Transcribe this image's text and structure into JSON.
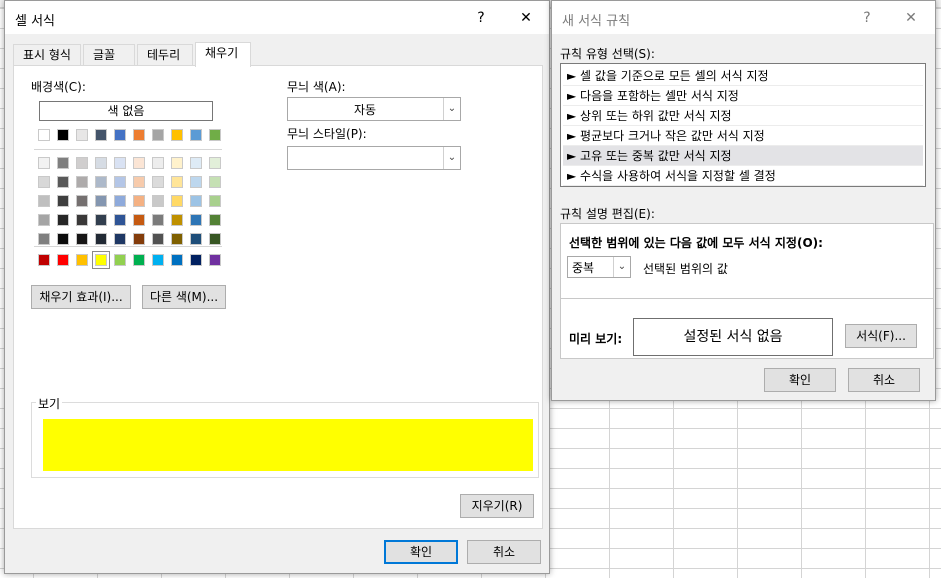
{
  "cell_format_dialog": {
    "title": "셀 서식",
    "help_glyph": "?",
    "close_glyph": "✕",
    "tabs": [
      {
        "label": "표시 형식",
        "active": false
      },
      {
        "label": "글꼴",
        "active": false
      },
      {
        "label": "테두리",
        "active": false
      },
      {
        "label": "채우기",
        "active": true
      }
    ],
    "background_color_label": "배경색(C):",
    "no_color_label": "색 없음",
    "pattern_color_label": "무늬 색(A):",
    "pattern_color_value": "자동",
    "pattern_style_label": "무늬 스타일(P):",
    "pattern_style_value": "",
    "fill_effects_button": "채우기 효과(I)...",
    "more_colors_button": "다른 색(M)...",
    "sample_label": "보기",
    "sample_color": "#ffff00",
    "clear_button": "지우기(R)",
    "ok_button": "확인",
    "cancel_button": "취소",
    "palette": {
      "theme_row": [
        "#ffffff",
        "#000000",
        "#e7e6e6",
        "#44546a",
        "#4472c4",
        "#ed7d31",
        "#a5a5a5",
        "#ffc000",
        "#5b9bd5",
        "#70ad47"
      ],
      "shades": [
        [
          "#f2f2f2",
          "#7f7f7f",
          "#d0cece",
          "#d6dce4",
          "#d9e2f3",
          "#fbe5d5",
          "#ededed",
          "#fff2cc",
          "#deebf6",
          "#e2efd9"
        ],
        [
          "#d8d8d8",
          "#595959",
          "#aeabab",
          "#adb9ca",
          "#b4c6e7",
          "#f7cbac",
          "#dbdbdb",
          "#ffe599",
          "#bdd7ee",
          "#c5e0b3"
        ],
        [
          "#bfbfbf",
          "#3f3f3f",
          "#757070",
          "#8496b0",
          "#8eaadb",
          "#f4b183",
          "#c9c9c9",
          "#ffd966",
          "#9cc3e5",
          "#a8d08d"
        ],
        [
          "#a5a5a5",
          "#262626",
          "#3a3838",
          "#323f4f",
          "#2f5496",
          "#c55a11",
          "#7b7b7b",
          "#bf9000",
          "#2e75b5",
          "#538135"
        ],
        [
          "#7f7f7f",
          "#0c0c0c",
          "#171616",
          "#222a35",
          "#1f3864",
          "#833c0b",
          "#525252",
          "#7f6000",
          "#1e4e79",
          "#375623"
        ]
      ],
      "standard_row": [
        "#c00000",
        "#ff0000",
        "#ffc000",
        "#ffff00",
        "#92d050",
        "#00b050",
        "#00b0f0",
        "#0070c0",
        "#002060",
        "#7030a0"
      ],
      "selected_standard_index": 3
    }
  },
  "new_rule_dialog": {
    "title": "새 서식 규칙",
    "help_glyph": "?",
    "close_glyph": "✕",
    "rule_type_label": "규칙 유형 선택(S):",
    "rule_types": [
      {
        "label": "► 셀 값을 기준으로 모든 셀의 서식 지정",
        "selected": false
      },
      {
        "label": "► 다음을 포함하는 셀만 서식 지정",
        "selected": false
      },
      {
        "label": "► 상위 또는 하위 값만 서식 지정",
        "selected": false
      },
      {
        "label": "► 평균보다 크거나 작은 값만 서식 지정",
        "selected": false
      },
      {
        "label": "► 고유 또는 중복 값만 서식 지정",
        "selected": true
      },
      {
        "label": "► 수식을 사용하여 서식을 지정할 셀 결정",
        "selected": false
      }
    ],
    "edit_description_label": "규칙 설명 편집(E):",
    "format_all_label": "선택한 범위에 있는 다음 값에 모두 서식 지정(O):",
    "duplicate_select_value": "중복",
    "range_values_label": "선택된 범위의 값",
    "preview_label": "미리 보기:",
    "preview_text": "설정된 서식 없음",
    "format_button": "서식(F)...",
    "ok_button": "확인",
    "cancel_button": "취소"
  }
}
